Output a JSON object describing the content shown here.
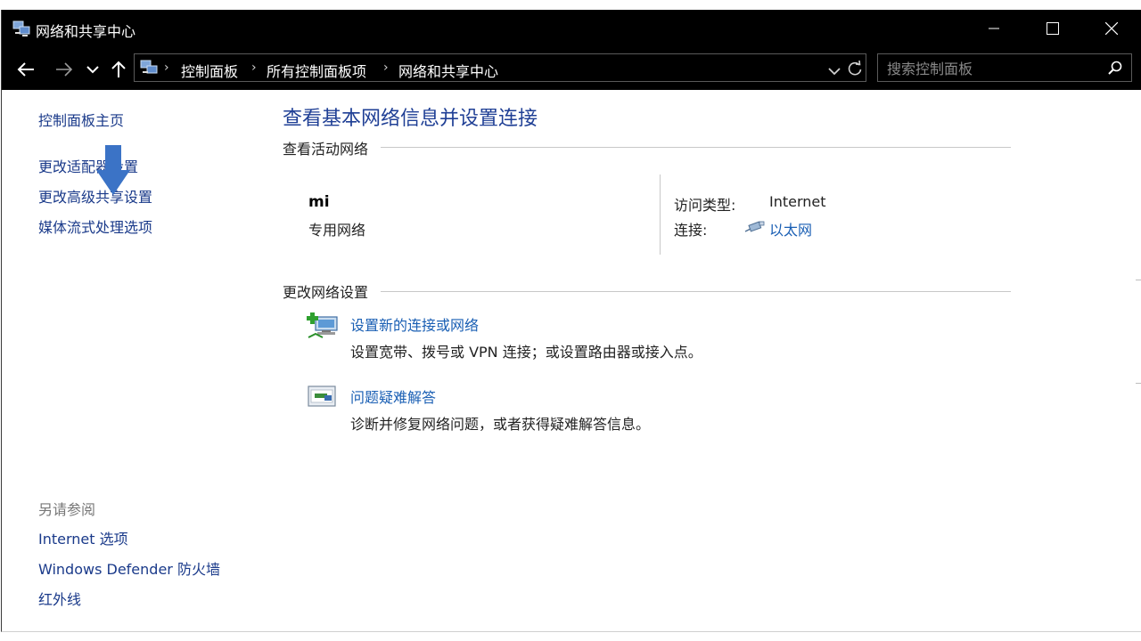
{
  "window": {
    "title": "网络和共享中心"
  },
  "address": {
    "crumbs": [
      "控制面板",
      "所有控制面板项",
      "网络和共享中心"
    ],
    "search_placeholder": "搜索控制面板"
  },
  "sidebar": {
    "home": "控制面板主页",
    "links": [
      "更改适配器设置",
      "更改高级共享设置",
      "媒体流式处理选项"
    ],
    "see_also_title": "另请参阅",
    "see_also": [
      "Internet 选项",
      "Windows Defender 防火墙",
      "红外线"
    ]
  },
  "main": {
    "title": "查看基本网络信息并设置连接",
    "active_networks_head": "查看活动网络",
    "network": {
      "name": "mi",
      "type": "专用网络",
      "access_label": "访问类型:",
      "access_value": "Internet",
      "connection_label": "连接:",
      "connection_value": "以太网"
    },
    "change_settings_head": "更改网络设置",
    "tasks": [
      {
        "title": "设置新的连接或网络",
        "desc": "设置宽带、拨号或 VPN 连接；或设置路由器或接入点。"
      },
      {
        "title": "问题疑难解答",
        "desc": "诊断并修复网络问题，或者获得疑难解答信息。"
      }
    ]
  },
  "colors": {
    "titlebar": "#000000",
    "link": "#1a5fb4",
    "heading": "#1f3f95",
    "overlay_arrow": "#3b73c6"
  }
}
